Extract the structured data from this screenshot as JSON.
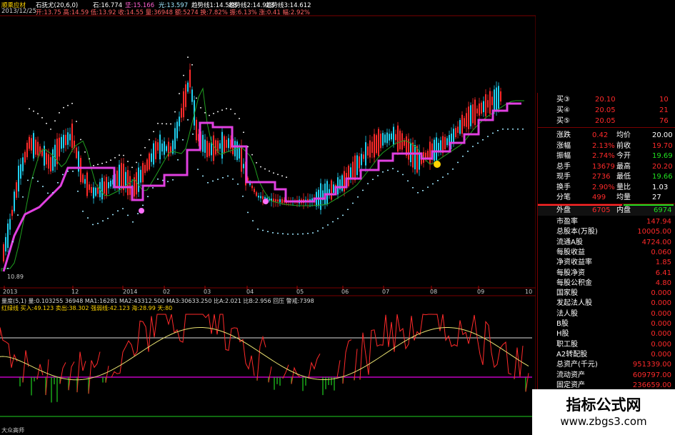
{
  "header": {
    "title": "顺乘应材",
    "indicator": "石抚尤(20,6,0)",
    "stone": "石:16.774",
    "jian": "坚:15.166",
    "light": "光:13.597",
    "trend1": "趋势线1:14.588",
    "trend2": "趋势线2:14.923",
    "trend3": "趋势线3:14.612",
    "date": "2013/12/25",
    "line2": "开:13.75 高:14.59 低:13.92 收:14.55 量:36948 额:5274 换:7.82% 振:6.13% 涨:0.41 幅:2.92%"
  },
  "price_axis": [
    "17.00",
    "16.00",
    "15.00",
    "14.00",
    "13.00",
    "12.00",
    "11.00",
    "10.00"
  ],
  "low_label": "10.89",
  "time_axis": [
    "2013",
    "12",
    "2014",
    "02",
    "03",
    "04",
    "05",
    "06",
    "07",
    "08",
    "09",
    "10"
  ],
  "time_unit": "日线",
  "vol_header": "量度(5,1) 量:0.103255 36948 MA1:16281 MA2:43312.500 MA3:30633.250 比A:2.021 比B:2.956 回压 警戒:7398",
  "osc_header": "红绿线 买入:49.123 卖出:38.302 强弱线:42.123 海:28.99 天:80",
  "footer_label": "大众高师",
  "colors": {
    "up": "#ff2a2a",
    "down": "#20d0f0",
    "trend": "#e040e0",
    "ma": "#20a020",
    "dots": "#e0e0e0"
  },
  "panel": {
    "bids": [
      {
        "name": "买③",
        "price": "20.10",
        "vol": "10"
      },
      {
        "name": "买④",
        "price": "20.05",
        "vol": "21"
      },
      {
        "name": "买⑤",
        "price": "20.05",
        "vol": "76"
      }
    ],
    "quote": [
      {
        "l": "涨跌",
        "v1": "0.42",
        "m": "均价",
        "v2": "20.00"
      },
      {
        "l": "涨幅",
        "v1": "2.13%",
        "m": "前收",
        "v2": "19.70"
      },
      {
        "l": "振幅",
        "v1": "2.74%",
        "m": "今开",
        "v2": "19.69"
      },
      {
        "l": "总手",
        "v1": "13679",
        "m": "最高",
        "v2": "20.20"
      },
      {
        "l": "现手",
        "v1": "2736",
        "m": "最低",
        "v2": "19.66"
      },
      {
        "l": "换手",
        "v1": "2.90%",
        "m": "量比",
        "v2": "1.03"
      },
      {
        "l": "分笔",
        "v1": "499",
        "m": "均量",
        "v2": "27"
      }
    ],
    "outer": {
      "l": "外盘",
      "v1": "6705",
      "m": "内盘",
      "v2": "6974"
    },
    "fundamentals": [
      {
        "l": "市盈率",
        "v": "147.94"
      },
      {
        "l": "总股本(万股)",
        "v": "10005.00"
      },
      {
        "l": "流通A股",
        "v": "4724.00"
      },
      {
        "l": "每股收益",
        "v": "0.060"
      },
      {
        "l": "净资收益率",
        "v": "1.85"
      },
      {
        "l": "每股净资",
        "v": "6.41"
      },
      {
        "l": "每股公积金",
        "v": "4.80"
      },
      {
        "l": "国家股",
        "v": "0.000"
      },
      {
        "l": "发起法人股",
        "v": "0.000"
      },
      {
        "l": "法人股",
        "v": "0.000"
      },
      {
        "l": "B股",
        "v": "0.000"
      },
      {
        "l": "H股",
        "v": "0.000"
      },
      {
        "l": "职工股",
        "v": "0.000"
      },
      {
        "l": "A2转配股",
        "v": "0.000"
      },
      {
        "l": "总资产(千元)",
        "v": "951339.00"
      },
      {
        "l": "流动资产",
        "v": "609797.00"
      },
      {
        "l": "固定资产",
        "v": "236659.00"
      }
    ]
  },
  "watermark": {
    "title": "指标公式网",
    "url": "www.zbgs3.com"
  }
}
